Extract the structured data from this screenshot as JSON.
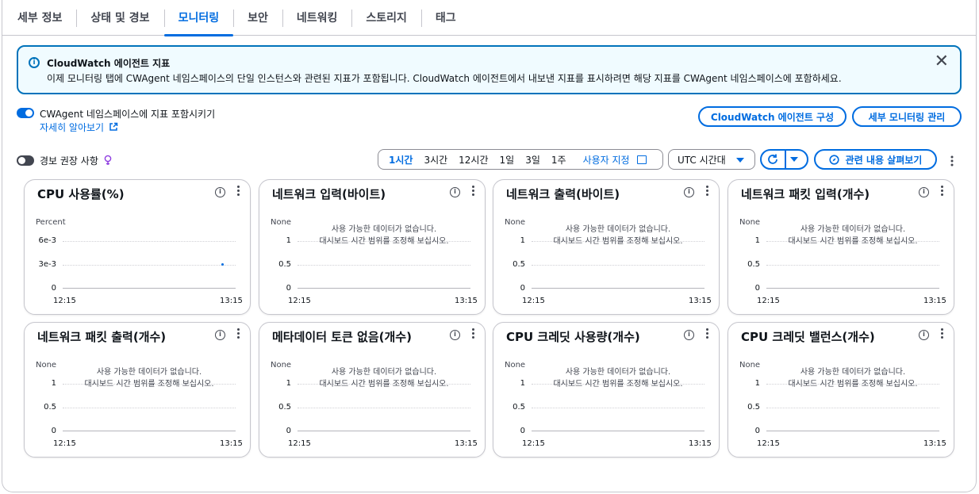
{
  "tabs": [
    "세부 정보",
    "상태 및 경보",
    "모니터링",
    "보안",
    "네트워킹",
    "스토리지",
    "태그"
  ],
  "active_tab": "모니터링",
  "alert": {
    "title": "CloudWatch 에이전트 지표",
    "body": "이제 모니터링 탭에 CWAgent 네임스페이스의 단일 인스턴스와 관련된 지표가 포함됩니다. CloudWatch 에이전트에서 내보낸 지표를 표시하려면 해당 지표를 CWAgent 네임스페이스에 포함하세요."
  },
  "toggle_cwagent": {
    "label": "CWAgent 네임스페이스에 지표 포함시키기",
    "on": true,
    "learn_more": "자세히 알아보기"
  },
  "toggle_alarm": {
    "label": "경보 권장 사항",
    "on": false
  },
  "buttons": {
    "configure_agent": "CloudWatch 에이전트 구성",
    "manage_monitoring": "세부 모니터링 관리",
    "explore": "관련 내용 살펴보기"
  },
  "time_ranges": [
    "1시간",
    "3시간",
    "12시간",
    "1일",
    "3일",
    "1주"
  ],
  "active_range": "1시간",
  "custom_range": "사용자 지정",
  "timezone": "UTC 시간대",
  "no_data": {
    "line1": "사용 가능한 데이터가 없습니다.",
    "line2": "대시보드 시간 범위를 조정해 보십시오."
  },
  "widgets": [
    {
      "title": "CPU 사용률(%)",
      "unit": "Percent",
      "yticks": [
        "6e-3",
        "3e-3",
        "0"
      ],
      "xticks": [
        "12:15",
        "13:15"
      ],
      "has_data": true
    },
    {
      "title": "네트워크 입력(바이트)",
      "unit": "None",
      "yticks": [
        "1",
        "0.5",
        "0"
      ],
      "xticks": [
        "12:15",
        "13:15"
      ],
      "has_data": false
    },
    {
      "title": "네트워크 출력(바이트)",
      "unit": "None",
      "yticks": [
        "1",
        "0.5",
        "0"
      ],
      "xticks": [
        "12:15",
        "13:15"
      ],
      "has_data": false
    },
    {
      "title": "네트워크 패킷 입력(개수)",
      "unit": "None",
      "yticks": [
        "1",
        "0.5",
        "0"
      ],
      "xticks": [
        "12:15",
        "13:15"
      ],
      "has_data": false
    },
    {
      "title": "네트워크 패킷 출력(개수)",
      "unit": "None",
      "yticks": [
        "1",
        "0.5",
        "0"
      ],
      "xticks": [
        "12:15",
        "13:15"
      ],
      "has_data": false
    },
    {
      "title": "메타데이터 토큰 없음(개수)",
      "unit": "None",
      "yticks": [
        "1",
        "0.5",
        "0"
      ],
      "xticks": [
        "12:15",
        "13:15"
      ],
      "has_data": false
    },
    {
      "title": "CPU 크레딧 사용량(개수)",
      "unit": "None",
      "yticks": [
        "1",
        "0.5",
        "0"
      ],
      "xticks": [
        "12:15",
        "13:15"
      ],
      "has_data": false
    },
    {
      "title": "CPU 크레딧 밸런스(개수)",
      "unit": "None",
      "yticks": [
        "1",
        "0.5",
        "0"
      ],
      "xticks": [
        "12:15",
        "13:15"
      ],
      "has_data": false
    }
  ],
  "chart_data": [
    {
      "type": "line",
      "title": "CPU 사용률(%)",
      "ylabel": "Percent",
      "ylim": [
        0,
        0.006
      ],
      "x": [
        "13:10"
      ],
      "series": [
        {
          "values": [
            0.003
          ]
        }
      ],
      "xrange": [
        "12:15",
        "13:15"
      ]
    }
  ],
  "colors": {
    "accent": "#006ce0",
    "alert_border": "#0073bb",
    "alert_bg": "#f0fbff"
  }
}
